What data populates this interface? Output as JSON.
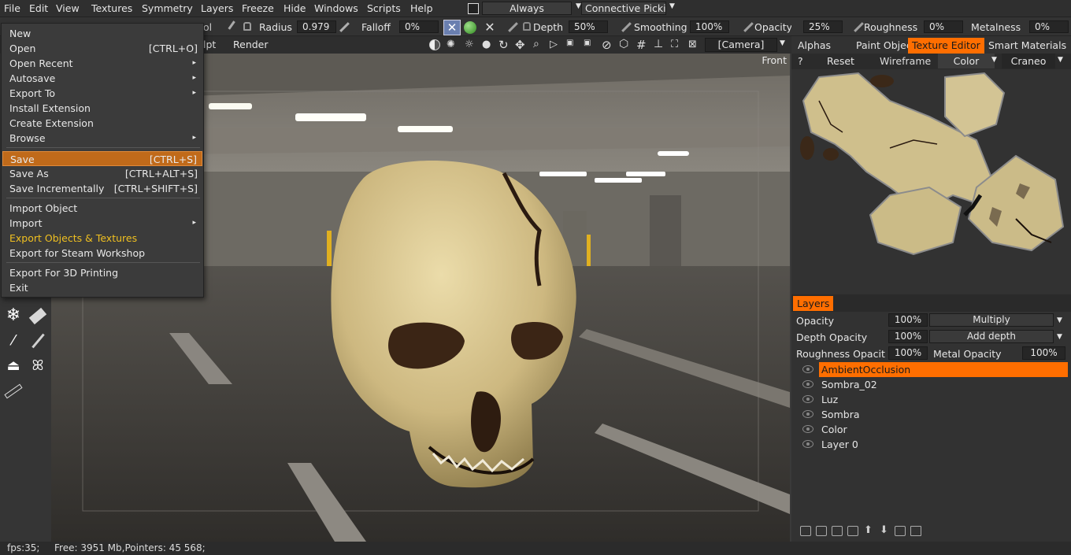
{
  "menubar": {
    "items": [
      "File",
      "Edit",
      "View",
      "Textures",
      "Symmetry",
      "Layers",
      "Freeze",
      "Hide",
      "Windows",
      "Scripts",
      "Help"
    ],
    "always_label": "Always",
    "picking_label": "Connective Picki"
  },
  "toolbar": {
    "radius_label": "Radius",
    "radius_value": "0.979",
    "falloff_label": "Falloff",
    "falloff_value": "0%",
    "depth_label": "Depth",
    "depth_value": "50%",
    "smoothing_label": "Smoothing",
    "smoothing_value": "100%",
    "opacity_label": "Opacity",
    "opacity_value": "25%",
    "roughness_label": "Roughness",
    "roughness_value": "0%",
    "metalness_label": "Metalness",
    "metalness_value": "0%",
    "partial_tool_text": "ol",
    "partial_sculpt_text": "lpt",
    "render_label": "Render",
    "camera_value": "[Camera]"
  },
  "viewport": {
    "view_label": "Front"
  },
  "file_menu": {
    "items": [
      {
        "label": "New",
        "shortcut": "",
        "submenu": false
      },
      {
        "label": "Open",
        "shortcut": "[CTRL+O]",
        "submenu": false
      },
      {
        "label": "Open Recent",
        "shortcut": "",
        "submenu": true
      },
      {
        "label": "Autosave",
        "shortcut": "",
        "submenu": true
      },
      {
        "label": "Export To",
        "shortcut": "",
        "submenu": true
      },
      {
        "label": "Install Extension",
        "shortcut": "",
        "submenu": false
      },
      {
        "label": "Create Extension",
        "shortcut": "",
        "submenu": false
      },
      {
        "label": "Browse",
        "shortcut": "",
        "submenu": true
      },
      {
        "label": "Save",
        "shortcut": "[CTRL+S]",
        "submenu": false
      },
      {
        "label": "Save As",
        "shortcut": "[CTRL+ALT+S]",
        "submenu": false
      },
      {
        "label": "Save Incrementally",
        "shortcut": "[CTRL+SHIFT+S]",
        "submenu": false
      },
      {
        "label": "Import Object",
        "shortcut": "",
        "submenu": false
      },
      {
        "label": "Import",
        "shortcut": "",
        "submenu": true
      },
      {
        "label": "Export Objects & Textures",
        "shortcut": "",
        "submenu": false
      },
      {
        "label": "Export for Steam Workshop",
        "shortcut": "",
        "submenu": false
      },
      {
        "label": "Export For 3D Printing",
        "shortcut": "",
        "submenu": false
      },
      {
        "label": "Exit",
        "shortcut": "",
        "submenu": false
      }
    ],
    "highlighted": "Save",
    "accent_item": "Export Objects & Textures"
  },
  "right_panel": {
    "tabs": [
      "Alphas",
      "Paint Objects",
      "Texture Editor",
      "Smart Materials"
    ],
    "active_tab": "Texture Editor",
    "texture_toolbar": {
      "help": "?",
      "reset": "Reset",
      "wireframe": "Wireframe",
      "color": "Color",
      "object": "Craneo"
    },
    "layers_title": "Layers",
    "props": {
      "opacity_label": "Opacity",
      "opacity_value": "100%",
      "blend_value": "Multiply",
      "depth_opacity_label": "Depth Opacity",
      "depth_opacity_value": "100%",
      "depth_mode_value": "Add depth",
      "roughness_opacity_label": "Roughness Opacit",
      "roughness_opacity_value": "100%",
      "metal_opacity_label": "Metal Opacity",
      "metal_opacity_value": "100%"
    },
    "layers": [
      "AmbientOcclusion",
      "Sombra_02",
      "Luz",
      "Sombra",
      "Color",
      "Layer 0"
    ],
    "active_layer": "AmbientOcclusion"
  },
  "status": {
    "fps": "fps:35;",
    "memory": "Free: 3951 Mb,Pointers: 45 568;"
  },
  "colors": {
    "accent": "#ff6e00",
    "menu_highlight": "#c06a1a",
    "accent_text": "#f0c020",
    "bone": "#d9c99a"
  },
  "icons": [
    "snowflake-icon",
    "eraser-icon",
    "magic-wand-icon",
    "eyedropper-icon",
    "iron-icon",
    "butterfly-icon",
    "ruler-icon"
  ]
}
